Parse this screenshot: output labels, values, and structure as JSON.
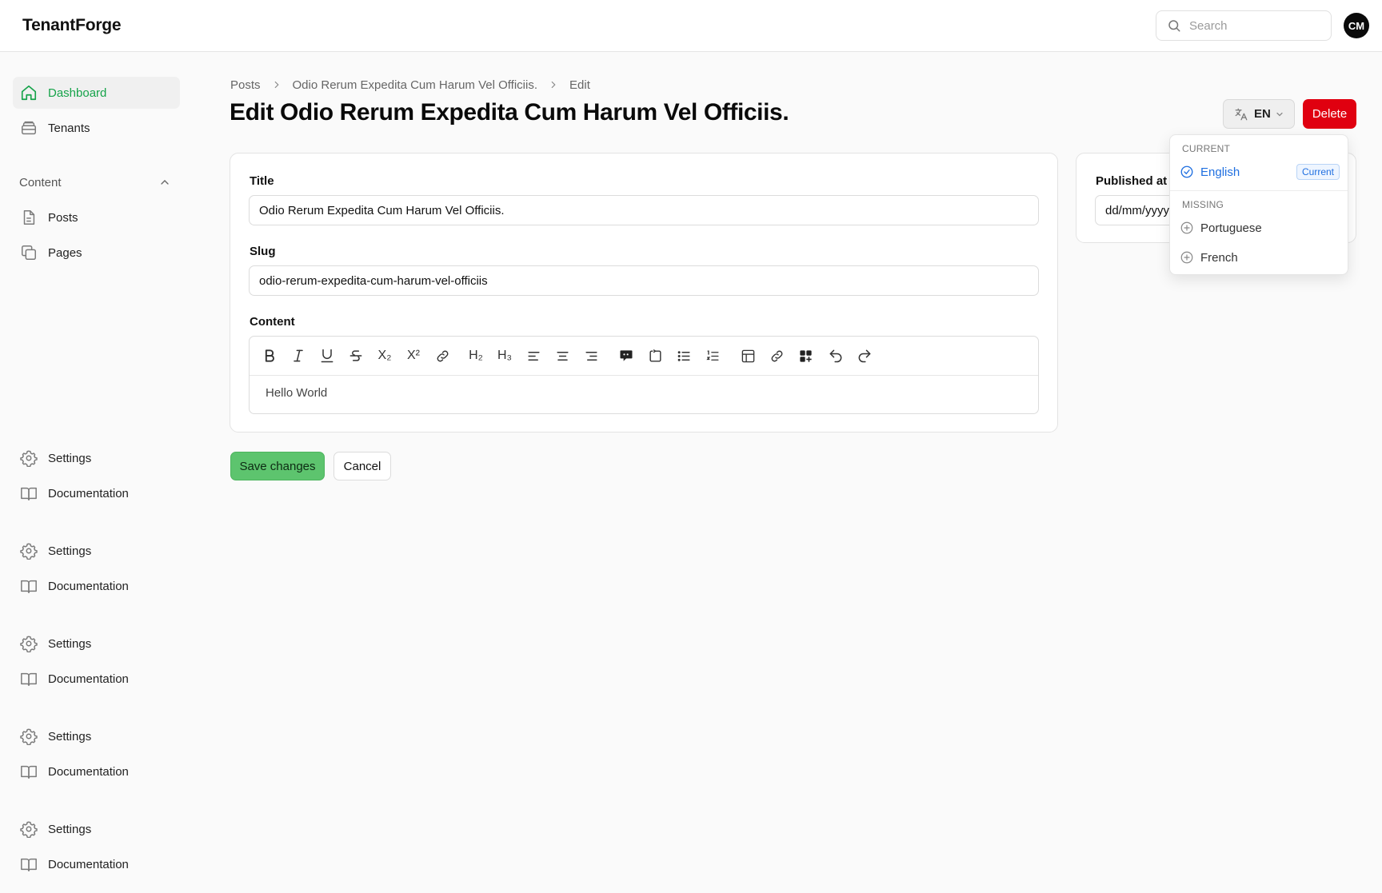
{
  "app": {
    "brand": "TenantForge"
  },
  "header": {
    "search_placeholder": "Search",
    "avatar_initials": "CM"
  },
  "sidebar": {
    "top_items": [
      {
        "label": "Dashboard",
        "icon": "home-icon",
        "active": true
      },
      {
        "label": "Tenants",
        "icon": "database-icon",
        "active": false
      }
    ],
    "group": {
      "label": "Content",
      "expanded": true
    },
    "content_items": [
      {
        "label": "Posts",
        "icon": "file-icon"
      },
      {
        "label": "Pages",
        "icon": "copy-icon"
      }
    ],
    "footer_items": [
      {
        "label": "Settings",
        "icon": "gear-icon"
      },
      {
        "label": "Documentation",
        "icon": "book-icon"
      },
      {
        "label": "Settings",
        "icon": "gear-icon"
      },
      {
        "label": "Documentation",
        "icon": "book-icon"
      },
      {
        "label": "Settings",
        "icon": "gear-icon"
      },
      {
        "label": "Documentation",
        "icon": "book-icon"
      },
      {
        "label": "Settings",
        "icon": "gear-icon"
      },
      {
        "label": "Documentation",
        "icon": "book-icon"
      },
      {
        "label": "Settings",
        "icon": "gear-icon"
      },
      {
        "label": "Documentation",
        "icon": "book-icon"
      }
    ]
  },
  "breadcrumb": [
    "Posts",
    "Odio Rerum Expedita Cum Harum Vel Officiis.",
    "Edit"
  ],
  "page": {
    "title": "Edit Odio Rerum Expedita Cum Harum Vel Officiis."
  },
  "actions": {
    "language": "EN",
    "delete_label": "Delete"
  },
  "form": {
    "title_label": "Title",
    "title_value": "Odio Rerum Expedita Cum Harum Vel Officiis.",
    "slug_label": "Slug",
    "slug_value": "odio-rerum-expedita-cum-harum-vel-officiis",
    "content_label": "Content",
    "content_value": "Hello World",
    "toolbar": [
      "bold",
      "italic",
      "underline",
      "strikethrough",
      "subscript",
      "superscript",
      "link",
      "heading-2",
      "heading-3",
      "align-left",
      "align-center",
      "align-right",
      "blockquote",
      "code-block",
      "bullet-list",
      "ordered-list",
      "table",
      "attach",
      "blocks",
      "undo",
      "redo"
    ],
    "toolbar_glyphs": {
      "subscript": "X₂",
      "superscript": "X²",
      "heading-2": "H₂",
      "heading-3": "H₃"
    }
  },
  "side": {
    "published_label": "Published at",
    "published_placeholder": "dd/mm/yyyy"
  },
  "buttons": {
    "save": "Save changes",
    "cancel": "Cancel"
  },
  "language_menu": {
    "current_heading": "CURRENT",
    "current_language": "English",
    "current_badge": "Current",
    "missing_heading": "MISSING",
    "missing_languages": [
      "Portuguese",
      "French"
    ]
  },
  "colors": {
    "accent_green": "#16a34a",
    "save_green": "#5dc46e",
    "danger": "#e00010",
    "link_blue": "#1f6fe0"
  }
}
